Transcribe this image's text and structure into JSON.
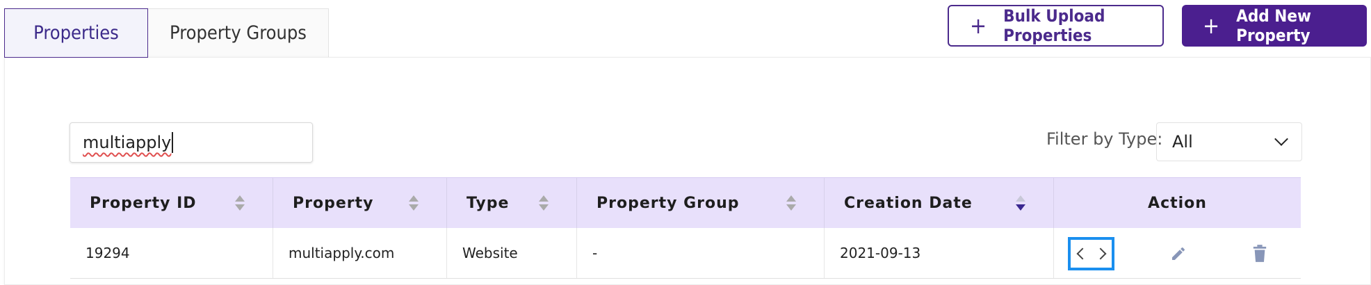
{
  "tabs": [
    {
      "label": "Properties",
      "active": true
    },
    {
      "label": "Property Groups",
      "active": false
    }
  ],
  "buttons": {
    "bulk_upload": "Bulk Upload Properties",
    "add_new": "Add New Property",
    "plus": "+"
  },
  "search": {
    "value": "multiapply"
  },
  "filter": {
    "label": "Filter by Type:",
    "selected": "All"
  },
  "table": {
    "columns": [
      "Property ID",
      "Property",
      "Type",
      "Property Group",
      "Creation Date",
      "Action"
    ],
    "rows": [
      {
        "id": "19294",
        "property": "multiapply.com",
        "type": "Website",
        "group": "-",
        "created": "2021-09-13"
      }
    ]
  },
  "icons": [
    "plus-icon",
    "chevron-down-icon",
    "sort-icon",
    "chevron-left-icon",
    "chevron-right-icon",
    "pencil-icon",
    "trash-icon"
  ],
  "colors": {
    "brand": "#4b1f8f",
    "header_bg": "#e8e0fb",
    "focus": "#1a8fef"
  }
}
